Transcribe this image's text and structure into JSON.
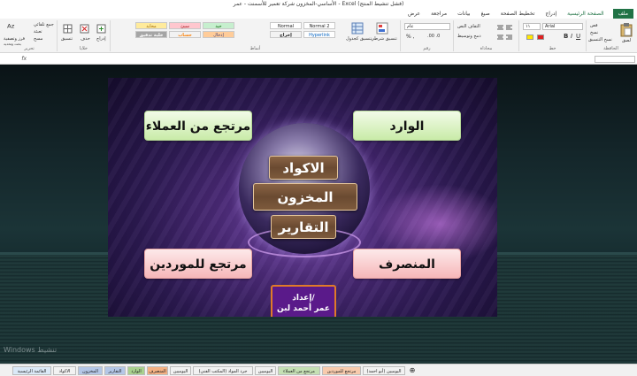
{
  "window": {
    "title": "الأساسي-المخزون شركة تعمير للأسمنت - عمر - Excel (فشل تنشيط المنتج)"
  },
  "ribbon_tabs": [
    {
      "label": "ملف"
    },
    {
      "label": "الصفحة الرئيسية"
    },
    {
      "label": "إدراج"
    },
    {
      "label": "تخطيط الصفحة"
    },
    {
      "label": "صيغ"
    },
    {
      "label": "بيانات"
    },
    {
      "label": "مراجعة"
    },
    {
      "label": "عرض"
    }
  ],
  "ribbon": {
    "clipboard": {
      "paste": "لصق",
      "cut": "قص",
      "copy": "نسخ",
      "format_painter": "نسخ التنسيق",
      "group": "الحافظة"
    },
    "font": {
      "name": "Arial",
      "size": "١١",
      "group": "خط"
    },
    "alignment": {
      "wrap": "التفاف النص",
      "merge": "دمج وتوسيط",
      "group": "محاذاة"
    },
    "number": {
      "format": "عام",
      "group": "رقم"
    },
    "styles": {
      "conditional": "تنسيق شرطي",
      "as_table": "تنسيق كجدول",
      "items": [
        {
          "label": "Normal",
          "bg": "#ffffff"
        },
        {
          "label": "Normal 2",
          "bg": "#ffffff"
        },
        {
          "label": "جيد",
          "bg": "#c6efce"
        },
        {
          "label": "سيئ",
          "bg": "#ffc7ce"
        },
        {
          "label": "محايد",
          "bg": "#ffeb9c"
        },
        {
          "label": "إخراج",
          "bg": "#f2f2f2"
        },
        {
          "label": "Hyperlink",
          "bg": "#ffffff"
        },
        {
          "label": "إدخال",
          "bg": "#ffcc99"
        },
        {
          "label": "حساب",
          "bg": "#f2f2f2"
        },
        {
          "label": "خلية تدقيق",
          "bg": "#a5a5a5"
        }
      ],
      "group": "أنماط"
    },
    "cells": {
      "insert": "إدراج",
      "delete": "حذف",
      "format": "تنسيق",
      "group": "خلايا"
    },
    "editing": {
      "autosum": "جمع تلقائي",
      "fill": "تعبئة",
      "clear": "مسح",
      "sort": "فرز وتصفية",
      "find": "بحث وتحديد",
      "group": "تحرير"
    }
  },
  "dashboard": {
    "buttons": {
      "incoming": "الوارد",
      "outgoing": "المنصرف",
      "customer_returns": "مرتجع من العملاء",
      "supplier_returns": "مرتجع للموردين",
      "codes": "الاكواد",
      "inventory": "المخزون",
      "reports": "التقارير"
    },
    "credit": {
      "line1": "إعداد/",
      "line2": "عمر أحمد لبن"
    }
  },
  "watermark": "Windows تنشيط",
  "sheet_tabs": [
    {
      "label": "القائمة الرئيسية",
      "color": "#dbe9f7"
    },
    {
      "label": "الاكواد",
      "color": "#f2f2f2"
    },
    {
      "label": "المخزون",
      "color": "#b4c7e7"
    },
    {
      "label": "التقارير",
      "color": "#b4c7e7"
    },
    {
      "label": "الوارد",
      "color": "#a9d18e"
    },
    {
      "label": "المنصرف",
      "color": "#f4b183"
    },
    {
      "label": "اليوميين",
      "color": "#f2f2f2"
    },
    {
      "label": "جرد المواد (المكتب الفني)",
      "color": "#f2f2f2"
    },
    {
      "label": "اليوميين",
      "color": "#f2f2f2"
    },
    {
      "label": "مرتجع من العملاء",
      "color": "#c5e0b4"
    },
    {
      "label": "مرتجع للموردين",
      "color": "#f8cbad"
    },
    {
      "label": "اليوميين (أبو احمد)",
      "color": "#f2f2f2"
    }
  ]
}
